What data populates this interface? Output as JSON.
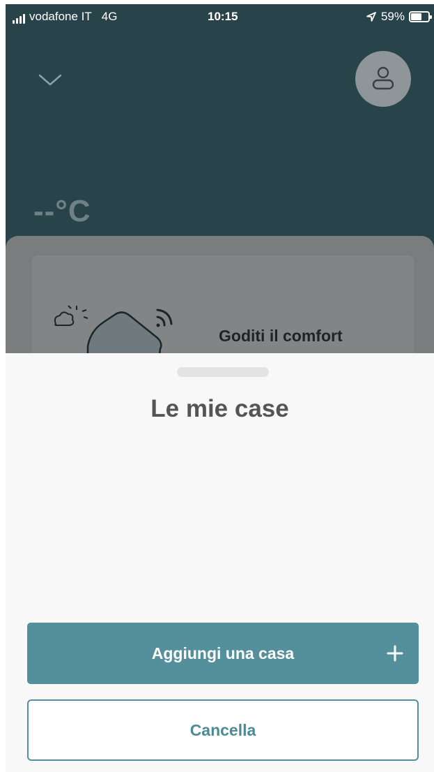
{
  "status_bar": {
    "carrier": "vodafone IT",
    "network": "4G",
    "time": "10:15",
    "battery_percent": "59%",
    "battery_level": 0.59,
    "icons": [
      "signal-icon",
      "location-arrow-icon",
      "battery-icon"
    ]
  },
  "background_screen": {
    "temperature": "--°C",
    "card_text": "Goditi il comfort",
    "icons": [
      "chevron-down-icon",
      "user-icon",
      "weather-icon",
      "wifi-icon"
    ],
    "colors": {
      "header_bg": "#29434a"
    }
  },
  "sheet": {
    "title": "Le mie case",
    "add_button_label": "Aggiungi una casa",
    "add_button_icon": "plus-icon",
    "cancel_button_label": "Cancella",
    "colors": {
      "accent": "#53909c",
      "sheet_bg": "#f8f8f8"
    }
  }
}
